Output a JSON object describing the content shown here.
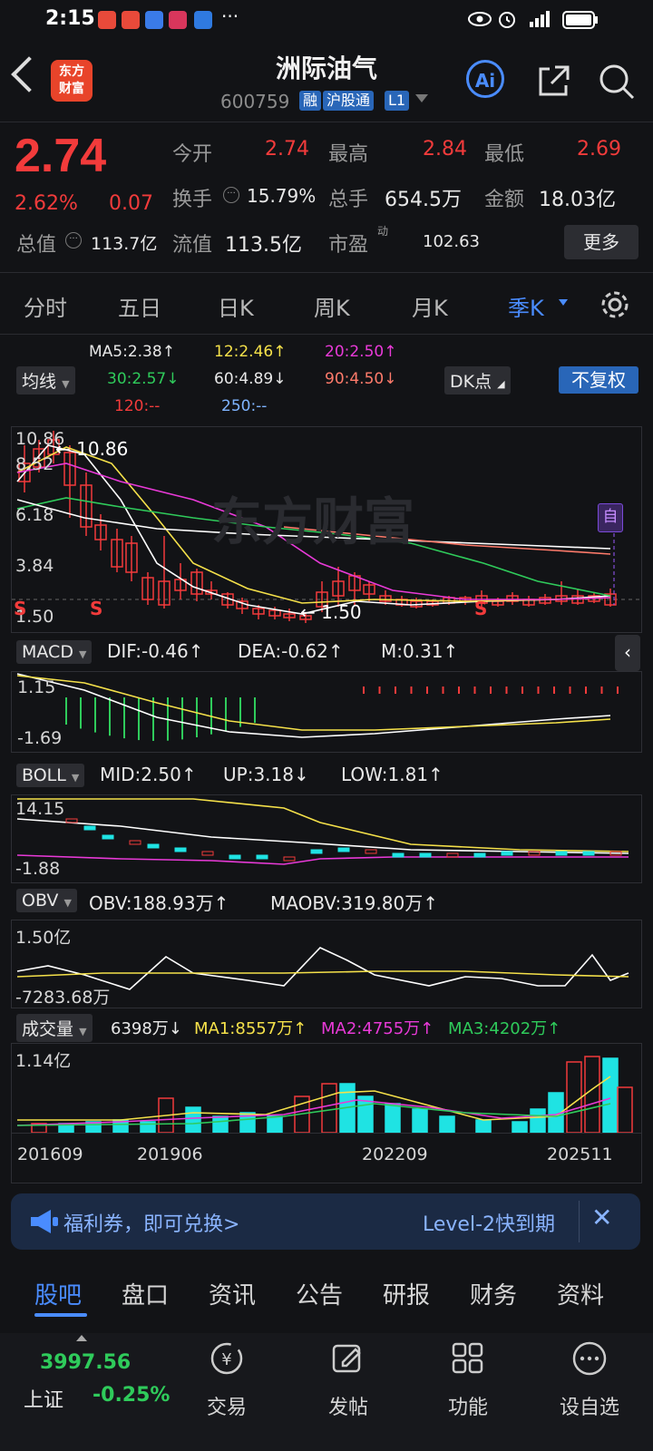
{
  "status_bar": {
    "time": "2:15"
  },
  "header": {
    "title": "洲际油气",
    "code": "600759",
    "tags": [
      "融",
      "沪股通",
      "L1"
    ],
    "ai_label": "Ai",
    "logo_text_line1": "东方",
    "logo_text_line2": "财富"
  },
  "quote": {
    "price": "2.74",
    "change_pct": "2.62%",
    "change": "0.07",
    "open_label": "今开",
    "open": "2.74",
    "high_label": "最高",
    "high": "2.84",
    "low_label": "最低",
    "low": "2.69",
    "turnover_label": "换手",
    "turnover": "15.79%",
    "volume_label": "总手",
    "volume": "654.5万",
    "amount_label": "金额",
    "amount": "18.03亿",
    "mktcap_label": "总值",
    "mktcap": "113.7亿",
    "float_label": "流值",
    "float": "113.5亿",
    "pe_label": "市盈",
    "pe_sup": "动",
    "pe": "102.63",
    "more": "更多"
  },
  "period_tabs": [
    "分时",
    "五日",
    "日K",
    "周K",
    "月K",
    "季K"
  ],
  "active_period": "季K",
  "ma_legend": {
    "selector": "均线",
    "ma5": "MA5:2.38↑",
    "ma12": "12:2.46↑",
    "ma20": "20:2.50↑",
    "ma30": "30:2.57↓",
    "ma60": "60:4.89↓",
    "ma90": "90:4.50↓",
    "ma120": "120:--",
    "ma250": "250:--",
    "dk_button": "DK点",
    "adjust_button": "不复权"
  },
  "main_chart": {
    "y_labels": [
      "10.86",
      "8.52",
      "6.18",
      "3.84",
      "1.50"
    ],
    "max_marker": "10.86",
    "min_marker": "1.50",
    "watermark": "东方财富",
    "self_tag": "自",
    "s_mark": "S",
    "colors": {
      "up": "#f23b3b",
      "down": "#1fe3e3",
      "ma5": "#ffffff",
      "ma12": "#f5e14a",
      "ma20": "#e93ad8",
      "ma30": "#2fcb5b",
      "ma60": "#ffffff",
      "ma90": "#ff7b6b"
    }
  },
  "macd": {
    "name": "MACD",
    "dif": "DIF:-0.46↑",
    "dea": "DEA:-0.62↑",
    "m": "M:0.31↑",
    "y_top": "1.15",
    "y_bottom": "-1.69"
  },
  "boll": {
    "name": "BOLL",
    "mid": "MID:2.50↑",
    "up": "UP:3.18↓",
    "low": "LOW:1.81↑",
    "y_top": "14.15",
    "y_bottom": "-1.88"
  },
  "obv": {
    "name": "OBV",
    "obv": "OBV:188.93万↑",
    "maobv": "MAOBV:319.80万↑",
    "y_top": "1.50亿",
    "y_bottom": "-7283.68万"
  },
  "volume": {
    "name": "成交量",
    "vol": "6398万↓",
    "ma1": "MA1:8557万↑",
    "ma2": "MA2:4755万↑",
    "ma3": "MA3:4202万↑",
    "y_top": "1.14亿",
    "x_labels": [
      "201609",
      "201906",
      "202209",
      "202511"
    ]
  },
  "banner": {
    "left_text": "福利券，即可兑换>",
    "right_text": "Level-2快到期"
  },
  "bottom_tabs": [
    "股吧",
    "盘口",
    "资讯",
    "公告",
    "研报",
    "财务",
    "资料"
  ],
  "active_bottom_tab": "股吧",
  "index": {
    "value": "3997.56",
    "name": "上证",
    "change": "-0.25%"
  },
  "bottom_nav": [
    "交易",
    "发帖",
    "功能",
    "设自选"
  ]
}
